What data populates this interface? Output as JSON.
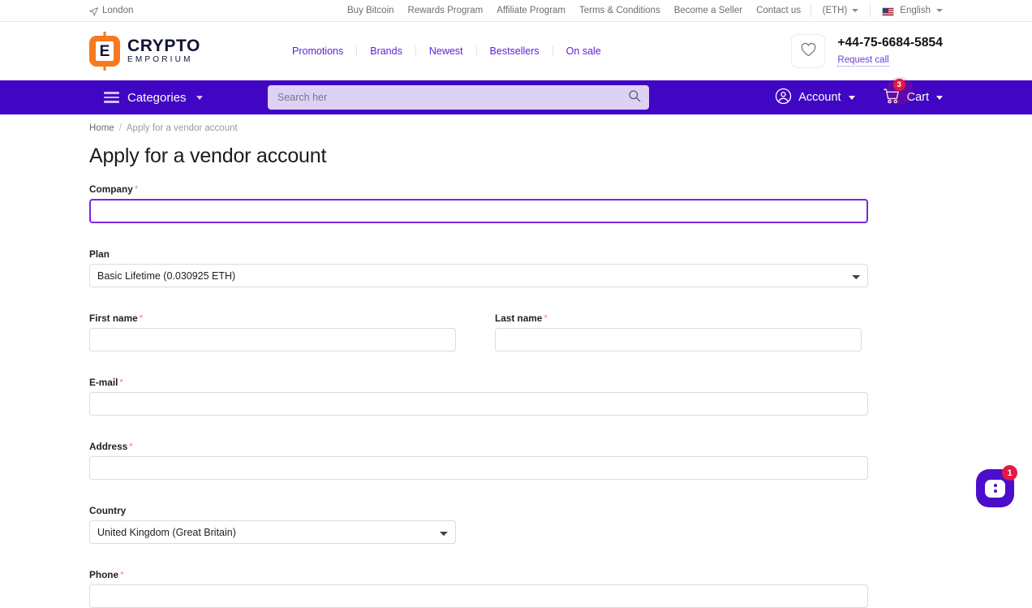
{
  "topbar": {
    "location": "London",
    "links": [
      {
        "label": "Buy Bitcoin"
      },
      {
        "label": "Rewards Program"
      },
      {
        "label": "Affiliate Program"
      },
      {
        "label": "Terms & Conditions"
      },
      {
        "label": "Become a Seller"
      },
      {
        "label": "Contact us"
      }
    ],
    "currency": "(ETH)",
    "language": "English"
  },
  "header": {
    "logo_letter": "E",
    "logo_line1": "CRYPTO",
    "logo_line2": "EMPORIUM",
    "nav": [
      {
        "label": "Promotions"
      },
      {
        "label": "Brands"
      },
      {
        "label": "Newest"
      },
      {
        "label": "Bestsellers"
      },
      {
        "label": "On sale"
      }
    ],
    "phone": "+44-75-6684-5854",
    "request_call": "Request call"
  },
  "navbar": {
    "categories": "Categories",
    "search_placeholder": "Search her",
    "search_value": "",
    "account": "Account",
    "cart": "Cart",
    "cart_count": "3"
  },
  "breadcrumb": {
    "home": "Home",
    "separator": "/",
    "current": "Apply for a vendor account"
  },
  "page": {
    "title": "Apply for a vendor account"
  },
  "form": {
    "company": {
      "label": "Company",
      "required": "*",
      "value": ""
    },
    "plan": {
      "label": "Plan",
      "selected": "Basic Lifetime (0.030925 ETH)",
      "options": [
        "Basic Lifetime (0.030925 ETH)"
      ]
    },
    "first_name": {
      "label": "First name",
      "required": "*",
      "value": ""
    },
    "last_name": {
      "label": "Last name",
      "required": "*",
      "value": ""
    },
    "email": {
      "label": "E-mail",
      "required": "*",
      "value": ""
    },
    "address": {
      "label": "Address",
      "required": "*",
      "value": ""
    },
    "country": {
      "label": "Country",
      "selected": "United Kingdom (Great Britain)",
      "options": [
        "United Kingdom (Great Britain)"
      ]
    },
    "phone": {
      "label": "Phone",
      "required": "*",
      "value": ""
    }
  },
  "chat": {
    "badge": "1"
  },
  "colors": {
    "purple_bar": "#4105c4",
    "accent_link": "#5b22d6",
    "focus_border": "#7b26e8",
    "logo_orange": "#f7791f",
    "badge_red": "#e3193f",
    "required_star": "#f08a7a"
  }
}
